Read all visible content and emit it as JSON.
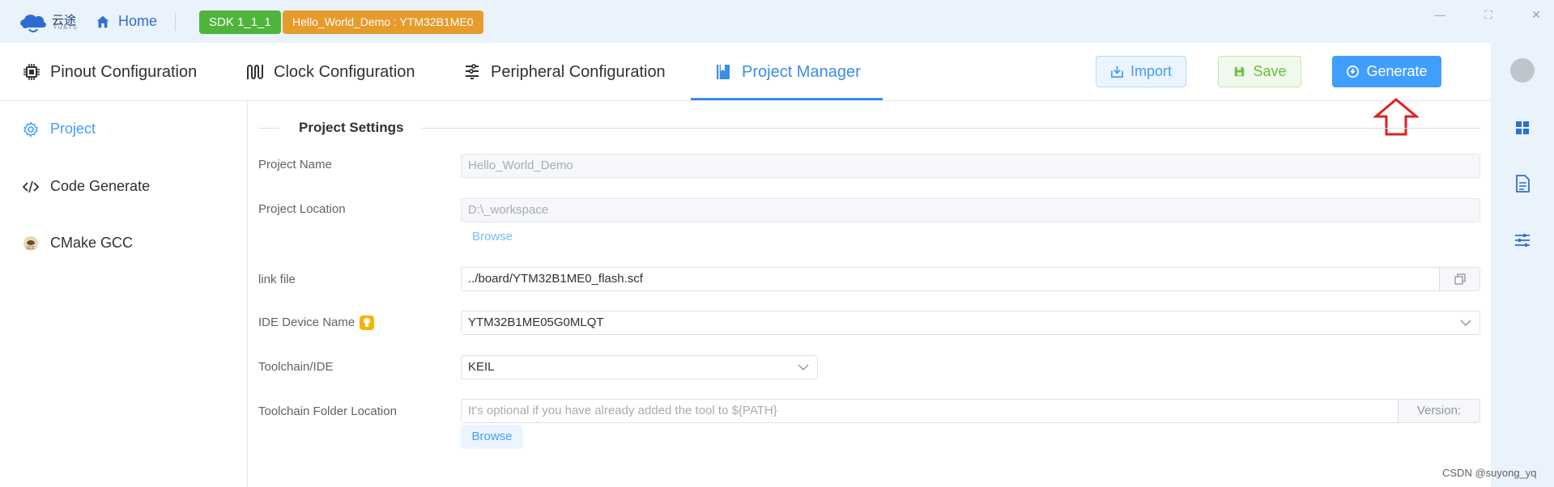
{
  "titlebar": {
    "logo_text": "云途",
    "logo_sub": "YUNTU",
    "home_label": "Home",
    "sdk_badge": "SDK  1_1_1",
    "project_badge": "Hello_World_Demo : YTM32B1ME0",
    "window_buttons": [
      "minimize-icon",
      "maximize-icon",
      "close-icon"
    ]
  },
  "tabs": [
    {
      "label": "Pinout Configuration",
      "icon": "chip-icon"
    },
    {
      "label": "Clock Configuration",
      "icon": "clock-wave-icon"
    },
    {
      "label": "Peripheral Configuration",
      "icon": "peripheral-icon"
    },
    {
      "label": "Project Manager",
      "icon": "book-icon",
      "active": true
    }
  ],
  "toolbar": {
    "import_label": "Import",
    "save_label": "Save",
    "generate_label": "Generate"
  },
  "sidebar": {
    "items": [
      {
        "label": "Project",
        "icon": "gear-icon",
        "active": true
      },
      {
        "label": "Code Generate",
        "icon": "code-icon"
      },
      {
        "label": "CMake GCC",
        "icon": "gcc-icon"
      }
    ]
  },
  "rightbar": {
    "icons": [
      "grid-icon",
      "document-icon",
      "sliders-icon"
    ]
  },
  "settings": {
    "section_title": "Project Settings",
    "project_name_label": "Project Name",
    "project_name_value": "Hello_World_Demo",
    "project_location_label": "Project Location",
    "project_location_value": "D:\\_workspace",
    "browse_label": "Browse",
    "link_file_label": "link file",
    "link_file_value": "../board/YTM32B1ME0_flash.scf",
    "ide_device_label": "IDE Device Name",
    "ide_device_value": "YTM32B1ME05G0MLQT",
    "toolchain_label": "Toolchain/IDE",
    "toolchain_value": "KEIL",
    "toolchain_folder_label": "Toolchain Folder Location",
    "toolchain_folder_placeholder": "It's optional if you have already added the tool to ${PATH}",
    "version_label": "Version:",
    "browse2_label": "Browse"
  },
  "watermark": "CSDN @suyong_yq",
  "colors": {
    "accent": "#409eff",
    "sdk_badge": "#4fb53a",
    "project_badge": "#e79b2b",
    "annotation_arrow": "#e02020"
  }
}
